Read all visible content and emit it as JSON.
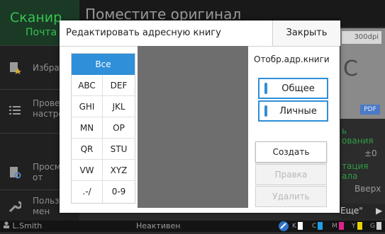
{
  "background": {
    "app_tab_title": "Сканир",
    "app_tab_subtitle": "Почта",
    "screen_title": "Поместите оригинал",
    "sidebar": [
      {
        "label": "Избран",
        "icon": "favorites-icon"
      },
      {
        "label": "Провер настро",
        "icon": "list-icon"
      },
      {
        "label": "Просм до от",
        "icon": "document-preview-icon"
      },
      {
        "label": "Польз мен",
        "icon": "wrench-icon"
      }
    ],
    "preview": {
      "dpi": "300dpi",
      "letter": "C",
      "badge": "PDF"
    },
    "right_panel": {
      "line1": "ь",
      "line2": "ования",
      "value": "±0",
      "line3": "тация",
      "line4": "ала",
      "direction": "Вверх"
    },
    "more_button": "Еще\"",
    "status": {
      "user": "L.Smith",
      "state": "Неактивен",
      "toner": [
        {
          "label": "K",
          "color": "#ffffff"
        },
        {
          "label": "C",
          "color": "#1ea0e6"
        },
        {
          "label": "M",
          "color": "#e0228c"
        },
        {
          "label": "Y",
          "color": "#e6d200"
        },
        {
          "label": "G",
          "color": "#cfcfcf"
        }
      ]
    }
  },
  "dialog": {
    "title": "Редактировать адресную книгу",
    "close_label": "Закрыть",
    "index_buttons": {
      "all": "Все",
      "rows": [
        [
          "ABC",
          "DEF"
        ],
        [
          "GHI",
          "JKL"
        ],
        [
          "MN",
          "OP"
        ],
        [
          "QR",
          "STU"
        ],
        [
          "VW",
          "XYZ"
        ],
        [
          ".-/",
          "0-9"
        ]
      ]
    },
    "view_label": "Отобр.адр.книги",
    "view_options": [
      {
        "label": "Общее",
        "selected": true
      },
      {
        "label": "Личные",
        "selected": true
      }
    ],
    "actions": {
      "create": "Создать",
      "edit": "Правка",
      "delete": "Удалить"
    }
  }
}
